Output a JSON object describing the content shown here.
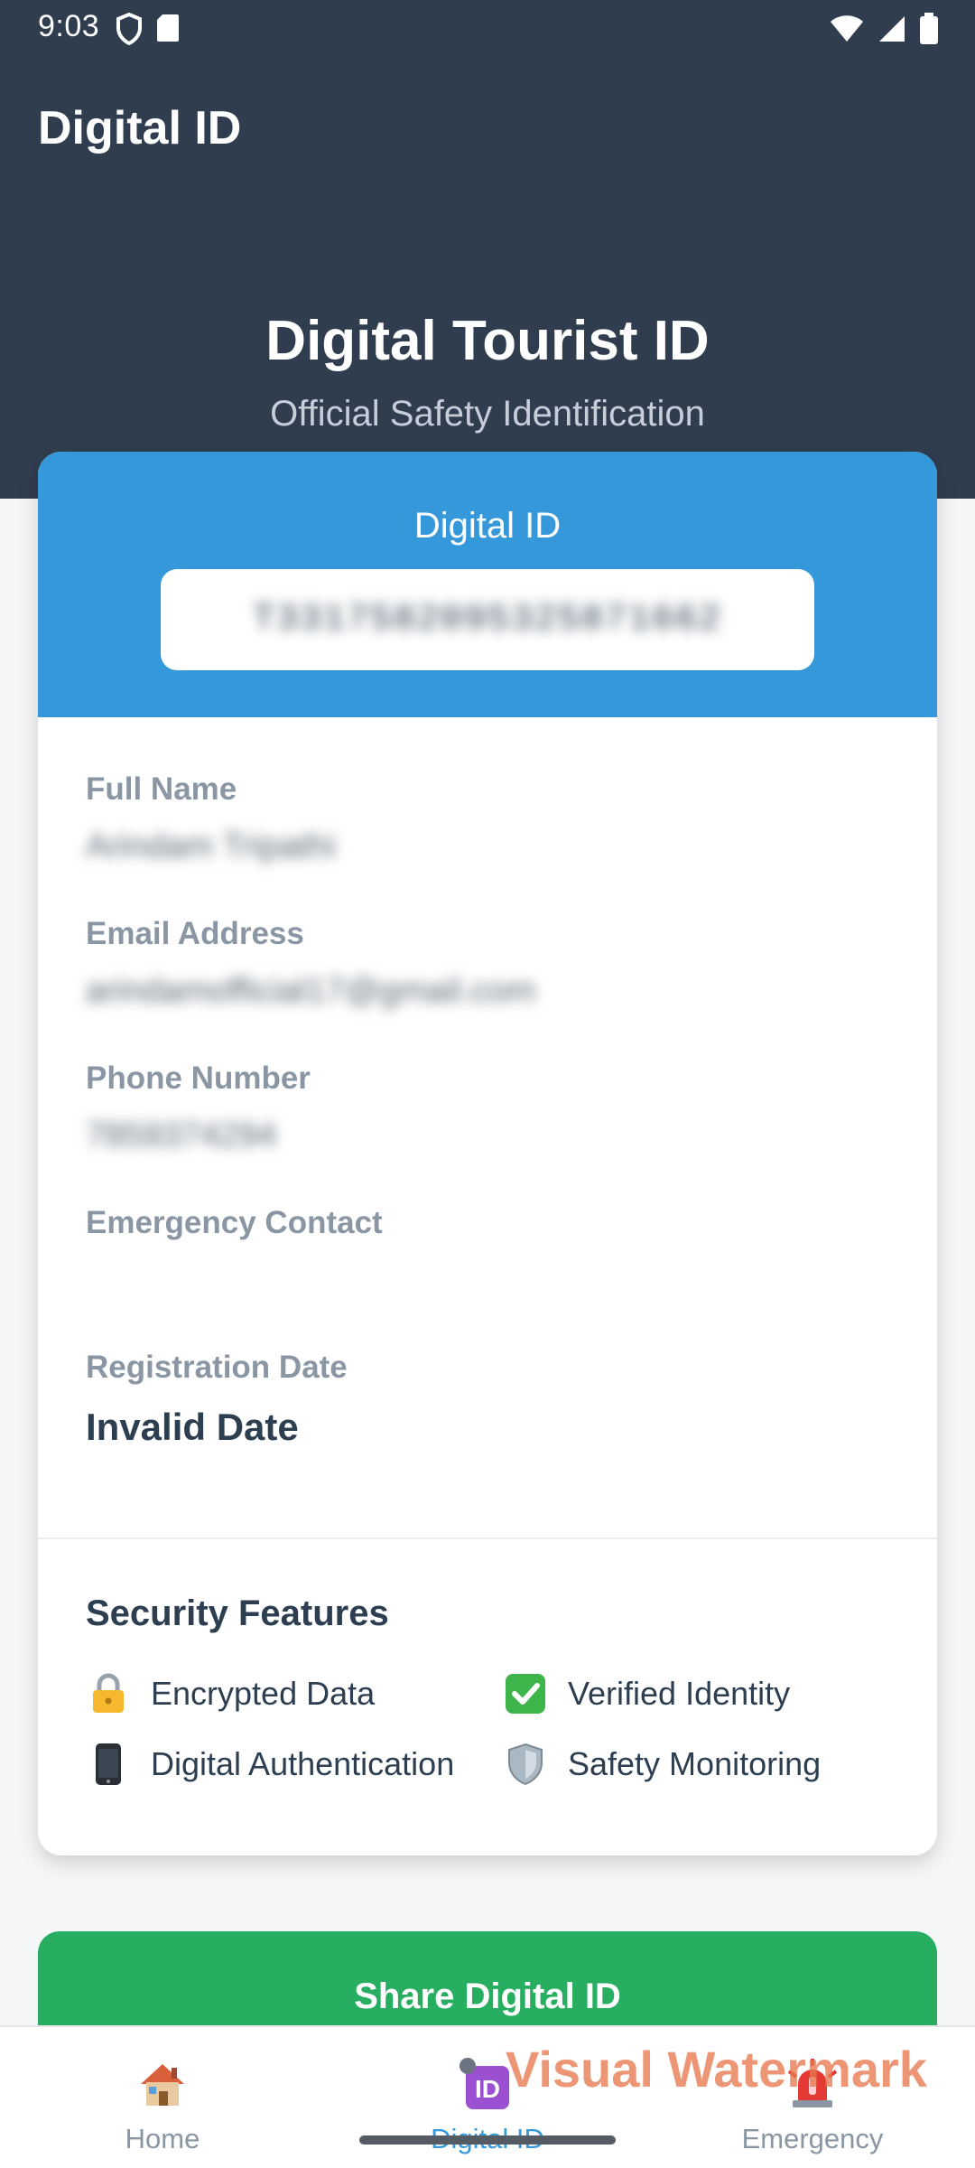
{
  "status_bar": {
    "time": "9:03"
  },
  "app_bar": {
    "title": "Digital ID"
  },
  "hero": {
    "title": "Digital Tourist ID",
    "subtitle": "Official Safety Identification"
  },
  "card": {
    "header_label": "Digital ID",
    "id_value": "T3317582095325871662",
    "fields": [
      {
        "label": "Full Name",
        "value": "Arindam Tripathi",
        "blurred": true
      },
      {
        "label": "Email Address",
        "value": "arindamofficial17@gmail.com",
        "blurred": true
      },
      {
        "label": "Phone Number",
        "value": "7859374294",
        "blurred": true
      },
      {
        "label": "Emergency Contact",
        "value": "",
        "blurred": false
      },
      {
        "label": "Registration Date",
        "value": "Invalid Date",
        "blurred": false
      }
    ],
    "security": {
      "title": "Security Features",
      "features": [
        {
          "label": "Encrypted Data",
          "icon": "lock-icon"
        },
        {
          "label": "Verified Identity",
          "icon": "check-mark-icon"
        },
        {
          "label": "Digital Authentication",
          "icon": "mobile-phone-icon"
        },
        {
          "label": "Safety Monitoring",
          "icon": "shield-icon"
        }
      ]
    }
  },
  "share_button": {
    "label": "Share Digital ID"
  },
  "bottom_nav": {
    "items": [
      {
        "label": "Home",
        "icon": "house-icon",
        "active": false
      },
      {
        "label": "Digital ID",
        "icon": "id-badge-icon",
        "active": true
      },
      {
        "label": "Emergency",
        "icon": "siren-icon",
        "active": false
      }
    ]
  },
  "watermark": {
    "text": "Visual Watermark"
  },
  "colors": {
    "header_bg": "#2f3d4f",
    "card_header_bg": "#3498db",
    "share_button_bg": "#27ae60",
    "active_nav": "#3498db"
  }
}
